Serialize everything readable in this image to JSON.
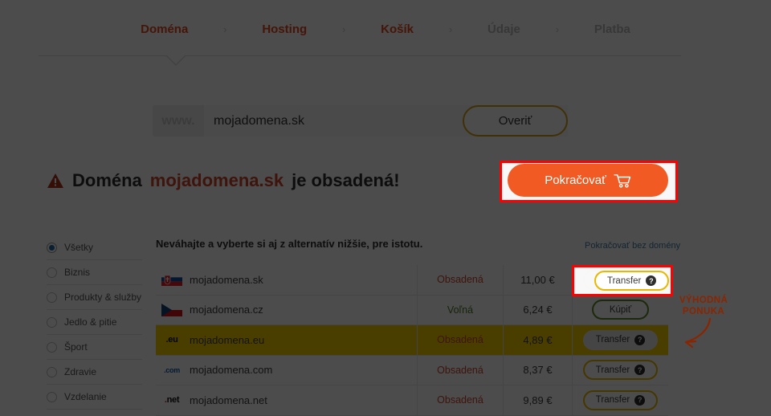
{
  "breadcrumb": {
    "separator": "›",
    "steps": [
      {
        "label": "Doména",
        "state": "active"
      },
      {
        "label": "Hosting",
        "state": "active"
      },
      {
        "label": "Košík",
        "state": "active"
      },
      {
        "label": "Údaje",
        "state": "inactive"
      },
      {
        "label": "Platba",
        "state": "inactive"
      }
    ]
  },
  "search": {
    "prefix": "www.",
    "value": "mojadomena.sk",
    "placeholder": "mojadomena.sk",
    "button_label": "Overiť"
  },
  "headline": {
    "icon": "warning-triangle-icon",
    "prefix": "Doména",
    "domain": "mojadomena.sk",
    "suffix": "je obsadená!"
  },
  "continue_button": {
    "label": "Pokračovať",
    "icon": "shopping-cart-icon",
    "color": "#f15a22"
  },
  "sidebar": {
    "items": [
      {
        "label": "Všetky",
        "selected": true
      },
      {
        "label": "Biznis",
        "selected": false
      },
      {
        "label": "Produkty & služby",
        "selected": false
      },
      {
        "label": "Jedlo & pitie",
        "selected": false
      },
      {
        "label": "Šport",
        "selected": false
      },
      {
        "label": "Zdravie",
        "selected": false
      },
      {
        "label": "Vzdelanie",
        "selected": false
      }
    ]
  },
  "alternatives": {
    "heading": "Neváhajte a vyberte si aj z alternatív nižšie, pre istotu.",
    "skip_link": "Pokračovať bez domény",
    "rows": [
      {
        "icon": "flag-sk-icon",
        "domain": "mojadomena.sk",
        "status": "Obsadená",
        "status_kind": "taken",
        "price": "11,00 €",
        "action": "Transfer",
        "action_kind": "transfer",
        "highlighted": false
      },
      {
        "icon": "flag-cz-icon",
        "domain": "mojadomena.cz",
        "status": "Voľná",
        "status_kind": "free",
        "price": "6,24 €",
        "action": "Kúpiť",
        "action_kind": "buy",
        "highlighted": false
      },
      {
        "icon": "tld-eu-icon",
        "domain": "mojadomena.eu",
        "status": "Obsadená",
        "status_kind": "taken",
        "price": "4,89 €",
        "action": "Transfer",
        "action_kind": "transfer-ghost",
        "highlighted": true
      },
      {
        "icon": "tld-com-icon",
        "domain": "mojadomena.com",
        "status": "Obsadená",
        "status_kind": "taken",
        "price": "8,37 €",
        "action": "Transfer",
        "action_kind": "transfer",
        "highlighted": false
      },
      {
        "icon": "tld-net-icon",
        "domain": "mojadomena.net",
        "status": "Obsadená",
        "status_kind": "taken",
        "price": "9,89 €",
        "action": "Transfer",
        "action_kind": "transfer",
        "highlighted": false
      }
    ],
    "help_badge": "?"
  },
  "annotations": {
    "offer_label_line1": "VÝHODNÁ",
    "offer_label_line2": "PONUKA",
    "highlight_color": "#ff0000",
    "label_color": "#8b2500"
  }
}
